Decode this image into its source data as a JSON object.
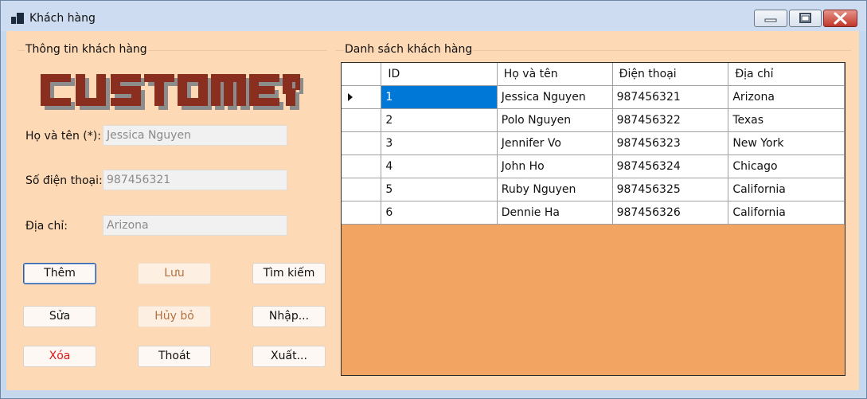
{
  "window": {
    "title": "Khách hàng",
    "icon": "app-window-icon",
    "controls": [
      "minimize-icon",
      "maximize-icon",
      "close-icon"
    ]
  },
  "left_panel": {
    "group_title": "Thông tin khách hàng",
    "logo_text": "CUSTOMER",
    "fields": [
      {
        "label": "Họ và tên (*):",
        "value": "Jessica Nguyen"
      },
      {
        "label": "Số điện thoại:",
        "value": "987456321"
      },
      {
        "label": "Địa chỉ:",
        "value": "Arizona"
      }
    ],
    "buttons": {
      "add": "Thêm",
      "save": "Lưu",
      "search": "Tìm kiếm",
      "edit": "Sửa",
      "cancel": "Hủy bỏ",
      "import": "Nhập...",
      "delete": "Xóa",
      "exit": "Thoát",
      "export": "Xuất..."
    }
  },
  "right_panel": {
    "group_title": "Danh sách khách hàng",
    "columns": [
      "ID",
      "Họ và tên",
      "Điện thoại",
      "Địa chỉ"
    ],
    "rows": [
      [
        "1",
        "Jessica Nguyen",
        "987456321",
        "Arizona"
      ],
      [
        "2",
        "Polo Nguyen",
        "987456322",
        "Texas"
      ],
      [
        "3",
        "Jennifer Vo",
        "987456323",
        "New York"
      ],
      [
        "4",
        "John Ho",
        "987456324",
        "Chicago"
      ],
      [
        "5",
        "Ruby Nguyen",
        "987456325",
        "California"
      ],
      [
        "6",
        "Dennie Ha",
        "987456326",
        "California"
      ]
    ],
    "selected_row": 0
  },
  "colors": {
    "form_background": "#fdd9b5",
    "grid_background": "#f2a563",
    "selection": "#0078d7",
    "logo_primary": "#8a2e1f",
    "logo_shadow": "#8c8c8c"
  }
}
